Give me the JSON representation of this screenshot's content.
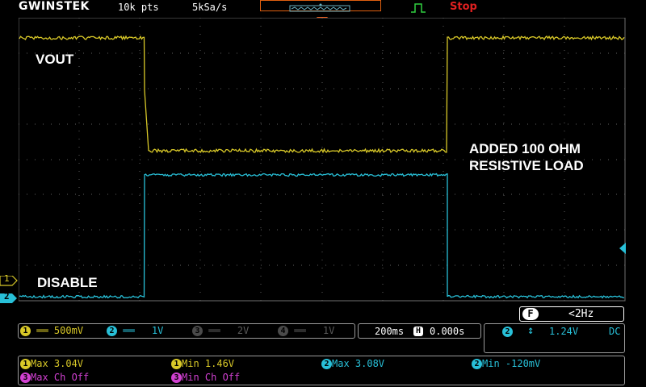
{
  "header": {
    "brand": "GWINSTEK",
    "record_length": "10k pts",
    "sample_rate": "5kSa/s",
    "run_state": "Stop",
    "trigger_icon": "rising-edge-trigger-icon"
  },
  "waveform_labels": {
    "vout": "VOUT",
    "disable": "DISABLE",
    "note_line1": "ADDED 100 OHM",
    "note_line2": "RESISTIVE LOAD"
  },
  "markers": {
    "ch1": "1",
    "ch2": "2"
  },
  "colors": {
    "ch1": "#d8c828",
    "ch2": "#28c0d8",
    "grid": "#606060",
    "stop": "#e02020",
    "math": "#d040d0"
  },
  "filter": {
    "badge": "F",
    "value": "<2Hz"
  },
  "channels": [
    {
      "num": "1",
      "coupling": "DC",
      "scale": "500mV",
      "active": true
    },
    {
      "num": "2",
      "coupling": "DC",
      "scale": "1V",
      "active": true
    },
    {
      "num": "3",
      "coupling": "DC",
      "scale": "2V",
      "active": false
    },
    {
      "num": "4",
      "coupling": "DC",
      "scale": "1V",
      "active": false
    }
  ],
  "timebase": {
    "scale": "200ms",
    "h_badge": "H",
    "position": "0.000s"
  },
  "trigger": {
    "source": "2",
    "level": "1.24V",
    "coupling": "DC"
  },
  "measurements": [
    {
      "src": "1",
      "text": "Max 3.04V"
    },
    {
      "src": "1",
      "text": "Min 1.46V"
    },
    {
      "src": "2",
      "text": "Max 3.08V"
    },
    {
      "src": "2",
      "text": "Min -120mV"
    },
    {
      "src": "3",
      "text": "Max Ch Off"
    },
    {
      "src": "3",
      "text": "Min Ch Off"
    }
  ]
}
